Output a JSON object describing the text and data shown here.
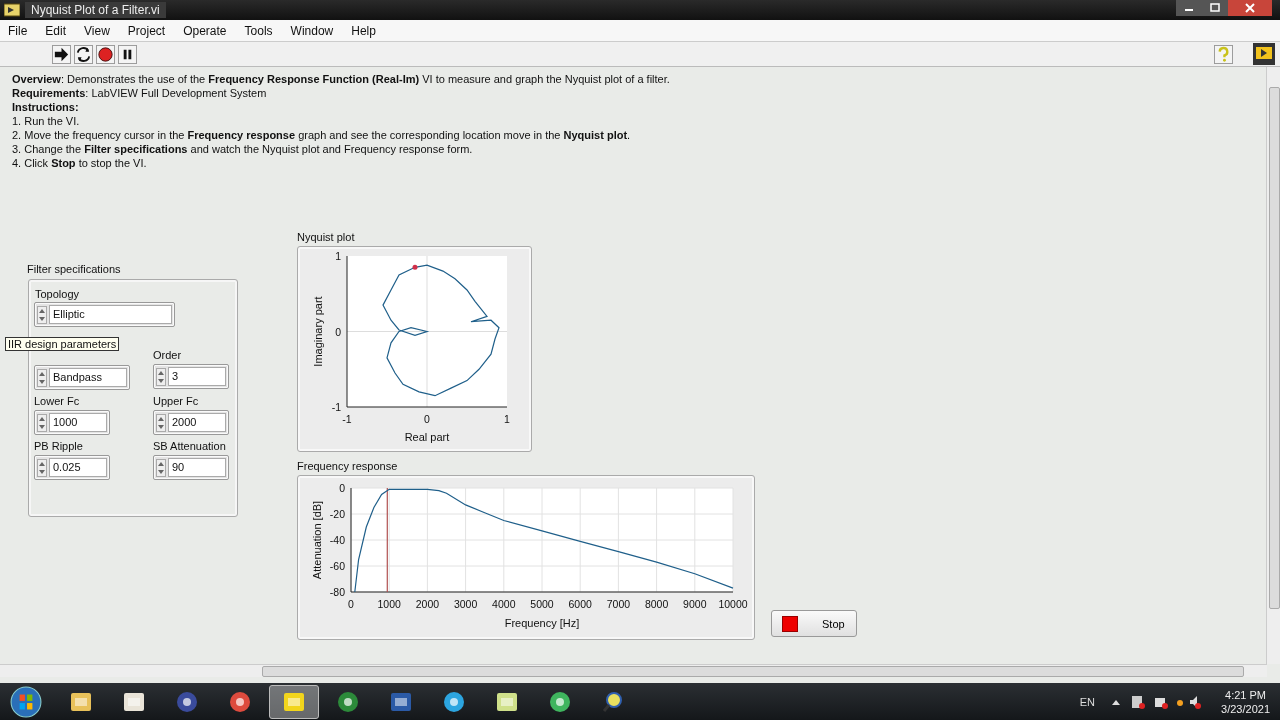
{
  "window": {
    "title": "Nyquist Plot of a Filter.vi"
  },
  "menu": [
    "File",
    "Edit",
    "View",
    "Project",
    "Operate",
    "Tools",
    "Window",
    "Help"
  ],
  "description": [
    {
      "text": "**Overview**: Demonstrates the use of the **Frequency Response Function (Real-Im)** VI to measure and graph the Nyquist plot of a filter.",
      "bold": false
    },
    {
      "text": "**Requirements**: LabVIEW Full Development System",
      "bold": false
    },
    {
      "text": "Instructions:",
      "bold": true
    },
    {
      "text": "1. Run the VI.",
      "bold": false
    },
    {
      "text": "2. Move the frequency cursor in the **Frequency response** graph and see the corresponding location move in the **Nyquist plot**.",
      "bold": false
    },
    {
      "text": "3. Change the **Filter specifications** and watch the Nyquist plot and Frequency response form.",
      "bold": false
    },
    {
      "text": "4. Click **Stop** to stop the VI.",
      "bold": false
    }
  ],
  "filter_specs": {
    "label": "Filter specifications",
    "topology": {
      "label": "Topology",
      "value": "Elliptic"
    },
    "tooltip": "IIR design parameters",
    "fields": [
      {
        "value": "Bandpass"
      },
      {
        "label": "Order",
        "value": "3"
      },
      {
        "label": "Lower Fc",
        "value": "1000"
      },
      {
        "label": "Upper Fc",
        "value": "2000"
      },
      {
        "label": "PB Ripple",
        "value": "0.025"
      },
      {
        "label": "SB Attenuation",
        "value": "90"
      }
    ]
  },
  "nyquist": {
    "title": "Nyquist plot",
    "x_label": "Real part",
    "y_label": "Imaginary part",
    "x_ticks": [
      "-1",
      "0",
      "1"
    ],
    "y_ticks": [
      "1",
      "0",
      "-1"
    ]
  },
  "frequency_response": {
    "title": "Frequency response",
    "chart_data": {
      "type": "line",
      "xlabel": "Frequency [Hz]",
      "ylabel": "Attenuation [dB]",
      "xlim": [
        0,
        10000
      ],
      "ylim": [
        -80,
        0
      ],
      "xticks": [
        0,
        1000,
        2000,
        3000,
        4000,
        5000,
        6000,
        7000,
        8000,
        9000,
        10000
      ],
      "yticks": [
        0,
        -20,
        -40,
        -60,
        -80
      ],
      "grid": true,
      "x": [
        100,
        200,
        400,
        600,
        800,
        1000,
        1500,
        2000,
        2300,
        2500,
        3000,
        3500,
        4000,
        5000,
        6000,
        7000,
        8000,
        9000,
        10000
      ],
      "series": [
        {
          "color": "#1f5f8a",
          "values": [
            -80,
            -55,
            -30,
            -15,
            -5,
            -1,
            -1,
            -1,
            -2,
            -4,
            -13,
            -19,
            -25,
            -33,
            -41,
            -49,
            -57,
            -66,
            -77
          ]
        }
      ],
      "ref_lines": [
        {
          "axis": "x",
          "value": 950
        }
      ]
    }
  },
  "stop_button": {
    "label": "Stop"
  },
  "taskbar": {
    "apps": [
      {
        "kind": "folder",
        "selected": false
      },
      {
        "kind": "media",
        "selected": false
      },
      {
        "kind": "globe",
        "selected": false
      },
      {
        "kind": "browser",
        "selected": false
      },
      {
        "kind": "labview",
        "selected": true
      },
      {
        "kind": "download",
        "selected": false
      },
      {
        "kind": "word",
        "selected": false
      },
      {
        "kind": "telegram",
        "selected": false
      },
      {
        "kind": "files",
        "selected": false
      },
      {
        "kind": "send",
        "selected": false
      },
      {
        "kind": "search",
        "selected": false
      }
    ],
    "language": "EN",
    "time": "4:21 PM",
    "date": "3/23/2021"
  }
}
